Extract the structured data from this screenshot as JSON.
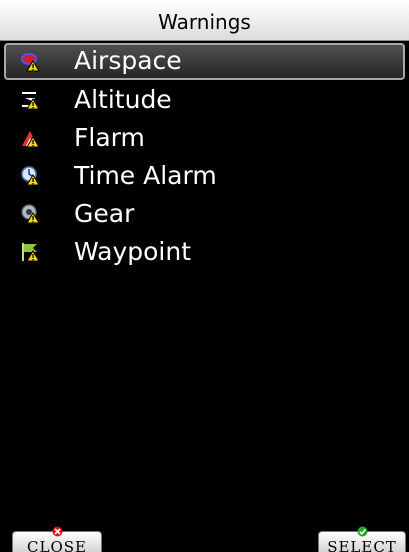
{
  "window": {
    "title": "Warnings"
  },
  "menu": {
    "items": [
      {
        "label": "Airspace",
        "icon": "airspace-warning-icon",
        "selected": true
      },
      {
        "label": "Altitude",
        "icon": "altitude-warning-icon",
        "selected": false
      },
      {
        "label": "Flarm",
        "icon": "flarm-warning-icon",
        "selected": false
      },
      {
        "label": "Time Alarm",
        "icon": "time-alarm-icon",
        "selected": false
      },
      {
        "label": "Gear",
        "icon": "gear-warning-icon",
        "selected": false
      },
      {
        "label": "Waypoint",
        "icon": "waypoint-flag-icon",
        "selected": false
      }
    ]
  },
  "buttons": {
    "close_label": "CLOSE",
    "close_icon": "close-x-icon",
    "select_label": "SELECT",
    "select_icon": "checkmark-icon"
  },
  "colors": {
    "background": "#000000",
    "title_bar": "#ffffff",
    "text": "#ffffff",
    "selection": "#404040",
    "warning_yellow": "#ffd500",
    "close_red": "#e01010",
    "select_green": "#22aa22"
  }
}
